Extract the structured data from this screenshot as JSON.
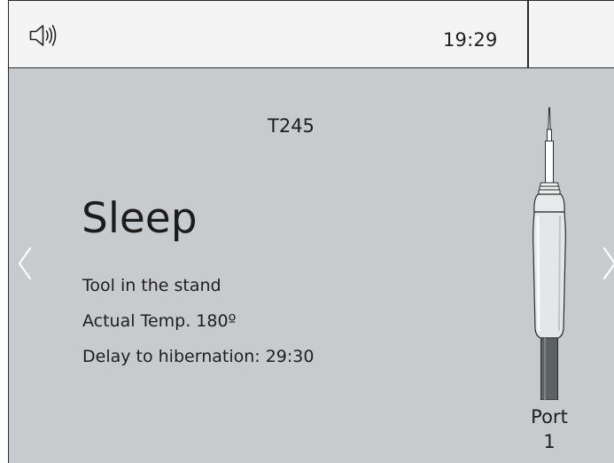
{
  "header": {
    "speaker_icon": "speaker-volume-icon",
    "time": "19:29"
  },
  "main": {
    "tool_name": "T245",
    "status": "Sleep",
    "details": [
      "Tool in the stand",
      "Actual Temp. 180º",
      "Delay to hibernation: 29:30"
    ],
    "port_label": "Port",
    "port_number": "1",
    "prev_icon": "chevron-left-icon",
    "next_icon": "chevron-right-icon",
    "tool_icon": "soldering-handpiece-icon"
  },
  "colors": {
    "header_bg": "#f4f4f4",
    "panel_bg": "#c7cbce",
    "text": "#1e1e1e",
    "arrow": "#ffffff"
  }
}
